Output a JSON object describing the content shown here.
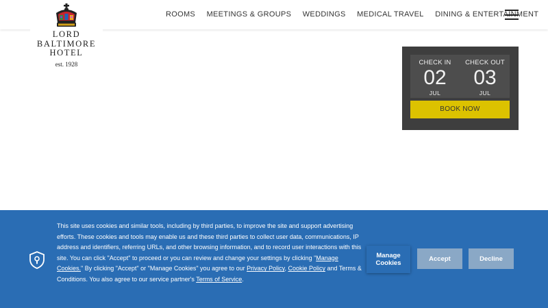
{
  "nav": {
    "items": [
      "ROOMS",
      "MEETINGS & GROUPS",
      "WEDDINGS",
      "MEDICAL TRAVEL",
      "DINING & ENTERTAINMENT"
    ],
    "menu_icon": "hamburger-icon"
  },
  "logo": {
    "line1": "LORD",
    "line2": "BALTIMORE",
    "line3": "HOTEL",
    "est": "est. 1928",
    "icon": "crown-icon"
  },
  "booking": {
    "check_in_label": "CHECK IN",
    "check_in_day": "02",
    "check_in_month": "JUL",
    "check_out_label": "CHECK OUT",
    "check_out_day": "03",
    "check_out_month": "JUL",
    "book_label": "BOOK NOW",
    "button_color": "#dcc200"
  },
  "cookie": {
    "text_part1": "This site uses cookies and similar tools, including by third parties, to improve the site and support advertising efforts. These cookies and tools may enable us and these third parties to collect user data, communications, IP address and identifiers, referring URLs, and other browsing information, and to record user interactions with this site. You can click \"Accept\" to proceed or you can review and change your settings by clicking \"",
    "manage_link": "Manage Cookies.",
    "text_part2": "\" By clicking \"Accept\" or \"Manage Cookies\" you agree to our ",
    "privacy_link": "Privacy Policy",
    "text_part3": ", ",
    "cookie_policy_link": "Cookie Policy",
    "text_part4": " and Terms & Conditions. You also agree to our service partner's ",
    "terms_link": "Terms of Service",
    "text_part5": ".",
    "manage_button": "Manage Cookies",
    "accept_button": "Accept",
    "decline_button": "Decline",
    "banner_color": "#2a6db4",
    "icon": "shield-lock-icon"
  }
}
